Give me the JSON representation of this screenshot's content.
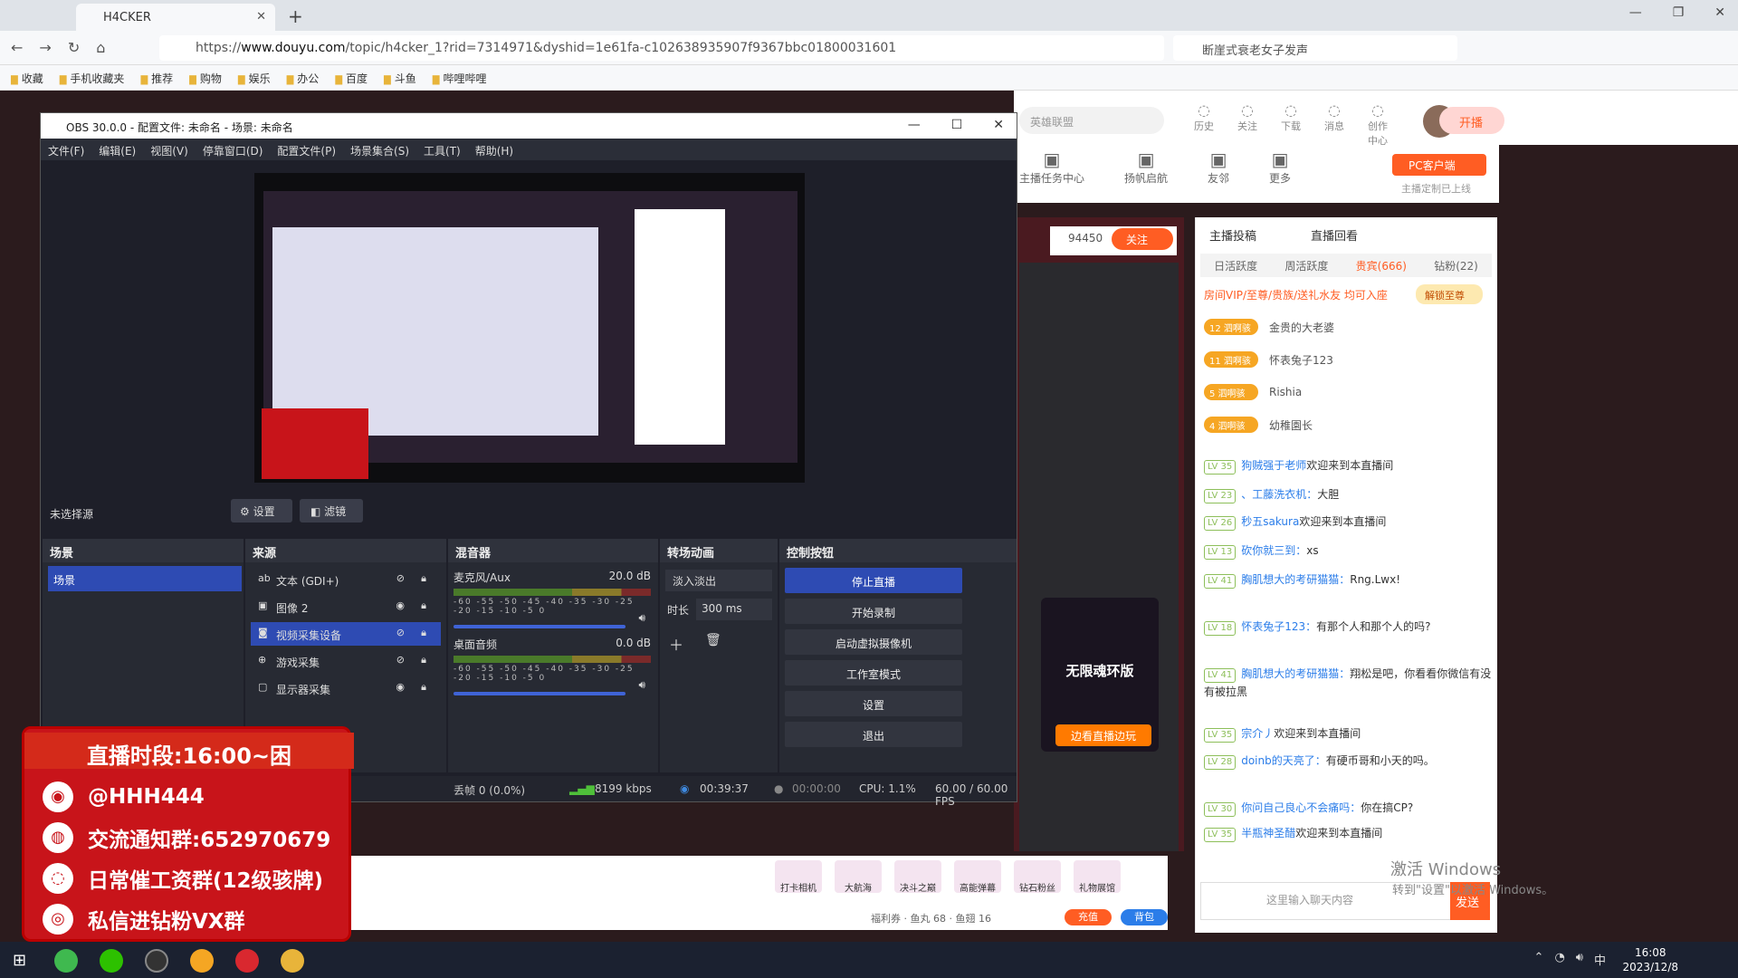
{
  "browser": {
    "tab_title": "H4CKER",
    "url_scheme": "https://",
    "url_domain": "www.douyu.com",
    "url_path": "/topic/h4cker_1?rid=7314971&dyshid=1e61fa-c102638935907f9367bbc01800031601",
    "search_text": "断崖式衰老女子发声",
    "bookmarks": [
      "收藏",
      "手机收藏夹",
      "推荐",
      "购物",
      "娱乐",
      "办公",
      "百度",
      "斗鱼",
      "哔哩哔哩"
    ]
  },
  "douyu": {
    "search_placeholder": "英雄联盟",
    "header_icons": [
      "历史",
      "关注",
      "下载",
      "消息",
      "创作中心"
    ],
    "live_btn": "开播",
    "sub_icons": [
      "主播任务中心",
      "扬帆启航",
      "友邻",
      "更多"
    ],
    "pc_client": "PC客户端",
    "pc_sub": "主播定制已上线",
    "fans": "94450",
    "follow": "关注",
    "game_title": "无限魂环版",
    "game_btn": "边看直播边玩",
    "right_tabs": [
      "主播投稿",
      "直播回看"
    ],
    "rank_tabs": [
      "日活跃度",
      "周活跃度",
      "贵宾(666)",
      "钻粉(22)"
    ],
    "vip_text": "房间VIP/至尊/贵族/送礼水友 均可入座",
    "unlock": "解锁至尊",
    "ranks": [
      {
        "badge": "12 泗啊骇",
        "name": "金贵的大老婆"
      },
      {
        "badge": "11 泗啊骇",
        "name": "怀表兔子123"
      },
      {
        "badge": "5 泗啊骇",
        "name": "Rishia"
      },
      {
        "badge": "4 泗啊骇",
        "name": "幼稚園长"
      }
    ],
    "chats": [
      {
        "lv": "LV 35",
        "nick": "狗贼强于老师",
        "msg": "欢迎来到本直播间"
      },
      {
        "lv": "LV 23",
        "nick": "、工藤洗衣机：",
        "msg": "大胆"
      },
      {
        "lv": "LV 26",
        "nick": "秒五sakura",
        "msg": "欢迎来到本直播间"
      },
      {
        "lv": "LV 13",
        "nick": "砍你就三到：",
        "msg": "xs"
      },
      {
        "lv": "LV 41",
        "nick": "胸肌想大的考研猫猫：",
        "msg": "Rng.Lwx!"
      },
      {
        "lv": "LV 18",
        "nick": "怀表兔子123：",
        "msg": "有那个人和那个人的吗?"
      },
      {
        "lv": "LV 41",
        "nick": "胸肌想大的考研猫猫：",
        "msg": "翔松是吧，你看看你微信有没有被拉黑"
      },
      {
        "lv": "LV 35",
        "nick": "宗介丿",
        "msg": "欢迎来到本直播间"
      },
      {
        "lv": "LV 28",
        "nick": "doinb的天亮了：",
        "msg": "有硬币哥和小天的吗。"
      },
      {
        "lv": "LV 30",
        "nick": "你问自己良心不会痛吗：",
        "msg": "你在搞CP?"
      },
      {
        "lv": "LV 35",
        "nick": "半瓶神圣醋",
        "msg": "欢迎来到本直播间"
      }
    ],
    "chat_placeholder": "这里输入聊天内容",
    "send": "发送",
    "gifts": [
      "打卡相机",
      "大航海",
      "决斗之巅",
      "高能弹幕",
      "钻石粉丝",
      "礼物展馆"
    ],
    "fuli": "福利券 · 鱼丸 68 · 鱼翅 16",
    "recharge": "充值",
    "bag": "背包",
    "activate_title": "激活 Windows",
    "activate_sub": "转到\"设置\"以激活 Windows。"
  },
  "obs": {
    "title": "OBS 30.0.0 - 配置文件: 未命名 - 场景: 未命名",
    "menu": [
      "文件(F)",
      "编辑(E)",
      "视图(V)",
      "停靠窗口(D)",
      "配置文件(P)",
      "场景集合(S)",
      "工具(T)",
      "帮助(H)"
    ],
    "no_source": "未选择源",
    "settings": "设置",
    "filters": "滤镜",
    "docks": {
      "scenes": "场景",
      "sources": "来源",
      "mixer": "混音器",
      "transitions": "转场动画",
      "controls": "控制按钮"
    },
    "scene_item": "场景",
    "sources": [
      {
        "icon": "ab",
        "label": "文本 (GDI+)",
        "visible": "⊘",
        "sel": false
      },
      {
        "icon": "▣",
        "label": "图像 2",
        "visible": "◉",
        "sel": false
      },
      {
        "icon": "◙",
        "label": "视频采集设备",
        "visible": "⊘",
        "sel": true
      },
      {
        "icon": "⊕",
        "label": "游戏采集",
        "visible": "⊘",
        "sel": false
      },
      {
        "icon": "▢",
        "label": "显示器采集",
        "visible": "◉",
        "sel": false
      }
    ],
    "mixer": [
      {
        "name": "麦克风/Aux",
        "db": "20.0 dB"
      },
      {
        "name": "桌面音频",
        "db": "0.0 dB"
      }
    ],
    "scale": "-60 -55 -50 -45 -40 -35 -30 -25 -20 -15 -10 -5 0",
    "transition": "淡入淡出",
    "duration_label": "时长",
    "duration": "300 ms",
    "controls": [
      "停止直播",
      "开始录制",
      "启动虚拟摄像机",
      "工作室模式",
      "设置",
      "退出"
    ],
    "status": {
      "dropped": "丢帧 0 (0.0%)",
      "bitrate": "8199 kbps",
      "live": "00:39:37",
      "rec": "00:00:00",
      "cpu": "CPU: 1.1%",
      "fps": "60.00 / 60.00 FPS"
    }
  },
  "overlay": {
    "title": "直播时段:16:00~困",
    "lines": [
      "@HHH444",
      "交流通知群:652970679",
      "日常催工资群(12级骇牌)",
      "私信进钻粉VX群"
    ]
  },
  "taskbar": {
    "time": "16:08",
    "date": "2023/12/8",
    "ime": "中"
  }
}
